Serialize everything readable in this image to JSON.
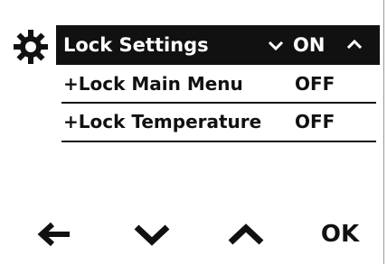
{
  "header": {
    "icon": "gear-icon",
    "title": "Lock Settings",
    "value": "ON"
  },
  "rows": [
    {
      "label": "+Lock Main Menu",
      "value": "OFF"
    },
    {
      "label": "+Lock Temperature",
      "value": "OFF"
    }
  ],
  "softkeys": {
    "back_icon": "arrow-left-icon",
    "down_icon": "chevron-down-icon",
    "up_icon": "chevron-up-icon",
    "ok_label": "OK"
  },
  "colors": {
    "background": "#ffffff",
    "foreground": "#111111",
    "header_text": "#ffffff"
  }
}
